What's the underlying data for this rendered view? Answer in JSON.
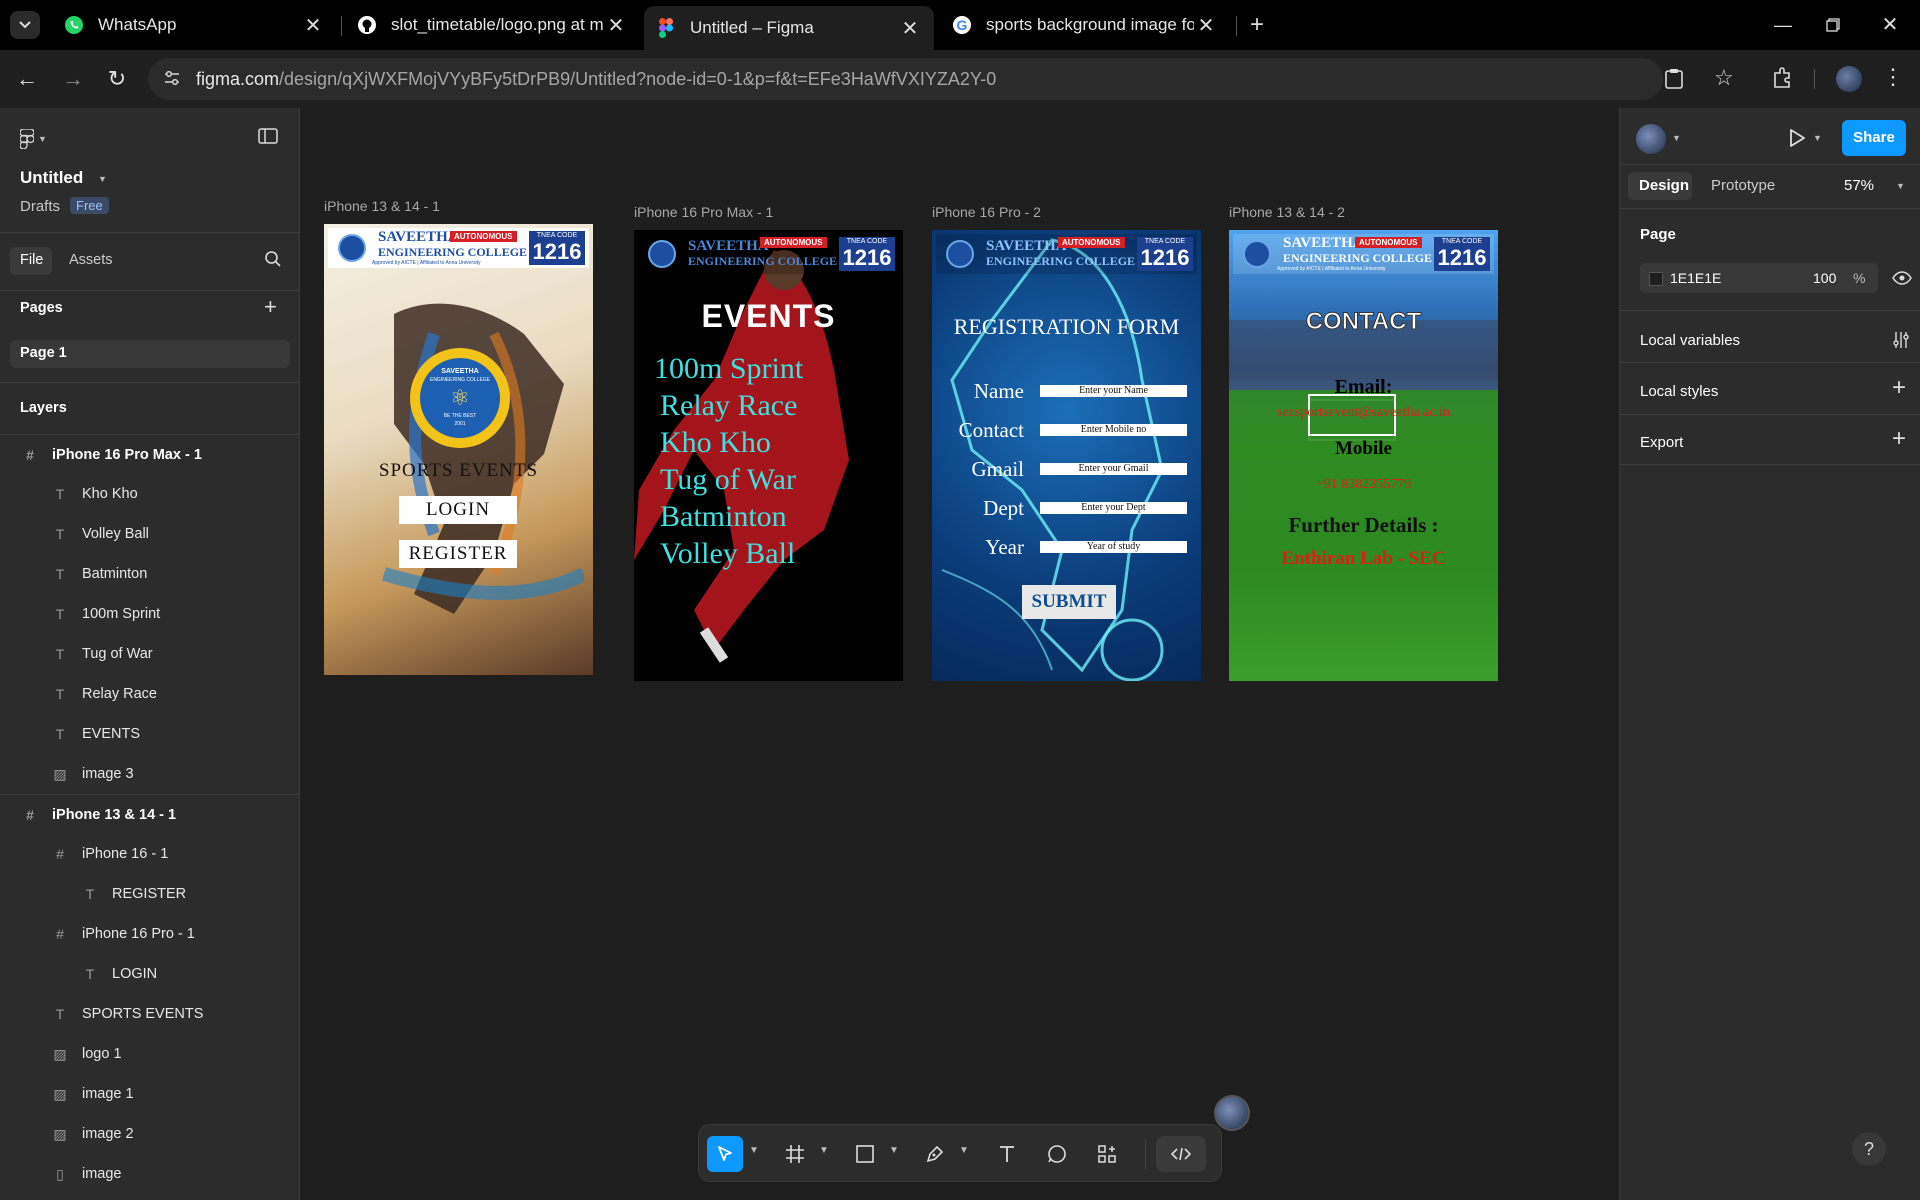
{
  "browser": {
    "tabs": [
      {
        "title": "WhatsApp",
        "icon": "whatsapp-icon"
      },
      {
        "title": "slot_timetable/logo.png at mai",
        "icon": "github-icon"
      },
      {
        "title": "Untitled – Figma",
        "icon": "figma-icon",
        "active": true
      },
      {
        "title": "sports background image for pl",
        "icon": "google-icon"
      }
    ],
    "url_host": "figma.com",
    "url_path": "/design/qXjWXFMojVYyBFy5tDrPB9/Untitled?node-id=0-1&p=f&t=EFe3HaWfVXIYZA2Y-0"
  },
  "left_panel": {
    "file_title": "Untitled",
    "drafts": "Drafts",
    "plan": "Free",
    "tab_file": "File",
    "tab_assets": "Assets",
    "pages_heading": "Pages",
    "current_page": "Page 1",
    "layers_heading": "Layers",
    "layers": [
      {
        "name": "iPhone 16 Pro Max - 1",
        "type": "frame",
        "indent": 0
      },
      {
        "name": "Kho Kho",
        "type": "text",
        "indent": 1
      },
      {
        "name": "Volley Ball",
        "type": "text",
        "indent": 1
      },
      {
        "name": "Batminton",
        "type": "text",
        "indent": 1
      },
      {
        "name": "100m Sprint",
        "type": "text",
        "indent": 1
      },
      {
        "name": "Tug of War",
        "type": "text",
        "indent": 1
      },
      {
        "name": "Relay Race",
        "type": "text",
        "indent": 1
      },
      {
        "name": "EVENTS",
        "type": "text",
        "indent": 1
      },
      {
        "name": "image 3",
        "type": "image",
        "indent": 1
      },
      {
        "name": "iPhone 13 & 14 - 1",
        "type": "frame",
        "indent": 0
      },
      {
        "name": "iPhone 16 - 1",
        "type": "frame",
        "indent": 1
      },
      {
        "name": "REGISTER",
        "type": "text",
        "indent": 2
      },
      {
        "name": "iPhone 16 Pro - 1",
        "type": "frame",
        "indent": 1
      },
      {
        "name": "LOGIN",
        "type": "text",
        "indent": 2
      },
      {
        "name": "SPORTS EVENTS",
        "type": "text",
        "indent": 1
      },
      {
        "name": "logo 1",
        "type": "image",
        "indent": 1
      },
      {
        "name": "image 1",
        "type": "image",
        "indent": 1
      },
      {
        "name": "image 2",
        "type": "image",
        "indent": 1
      },
      {
        "name": "image",
        "type": "rect",
        "indent": 1
      }
    ]
  },
  "right_panel": {
    "share": "Share",
    "tab_design": "Design",
    "tab_prototype": "Prototype",
    "zoom": "57%",
    "page_heading": "Page",
    "page_color": "1E1E1E",
    "page_opacity": "100",
    "percent": "%",
    "local_variables": "Local variables",
    "local_styles": "Local styles",
    "export": "Export"
  },
  "canvas": {
    "frames": [
      {
        "label": "iPhone 13 & 14 - 1"
      },
      {
        "label": "iPhone 16 Pro Max - 1"
      },
      {
        "label": "iPhone 16 Pro - 2"
      },
      {
        "label": "iPhone 13 & 14 - 2"
      }
    ],
    "banner": {
      "name_line1": "SAVEETHA",
      "name_line2": "ENGINEERING COLLEGE",
      "autonomous": "AUTONOMOUS",
      "tnea_label": "TNEA CODE",
      "tnea_code": "1216",
      "approved": "Approved by AICTE | Affiliated to Anna University"
    },
    "screen1": {
      "sports_events": "SPORTS EVENTS",
      "login": "LOGIN",
      "register": "REGISTER",
      "badge_top": "SAVEETHA",
      "badge_mid": "ENGINEERING COLLEGE",
      "badge_bottom": "BE THE BEST",
      "badge_year": "2001"
    },
    "screen2": {
      "events": "EVENTS",
      "items": [
        "100m Sprint",
        "Relay Race",
        "Kho Kho",
        "Tug of War",
        "Batminton",
        "Volley Ball"
      ]
    },
    "screen3": {
      "title": "REGISTRATION FORM",
      "fields": [
        {
          "label": "Name",
          "placeholder": "Enter your Name"
        },
        {
          "label": "Contact",
          "placeholder": "Enter Mobile no"
        },
        {
          "label": "Gmail",
          "placeholder": "Enter your Gmail"
        },
        {
          "label": "Dept",
          "placeholder": "Enter your Dept"
        },
        {
          "label": "Year",
          "placeholder": "Year of study"
        }
      ],
      "submit": "SUBMIT"
    },
    "screen4": {
      "title": "CONTACT",
      "email_label": "Email:",
      "email": "secsportsevent@saveetha.ac.in",
      "mobile_label": "Mobile",
      "mobile": "+91 8382355779",
      "further": "Further Details :",
      "lab": "Enthiran Lab - SEC"
    }
  },
  "colors": {
    "accent": "#0d99ff",
    "canvas_bg": "#1e1e1e",
    "panel_bg": "#2c2c2c",
    "cyan_text": "#3fe0e0",
    "red_text": "#e01b1b"
  }
}
